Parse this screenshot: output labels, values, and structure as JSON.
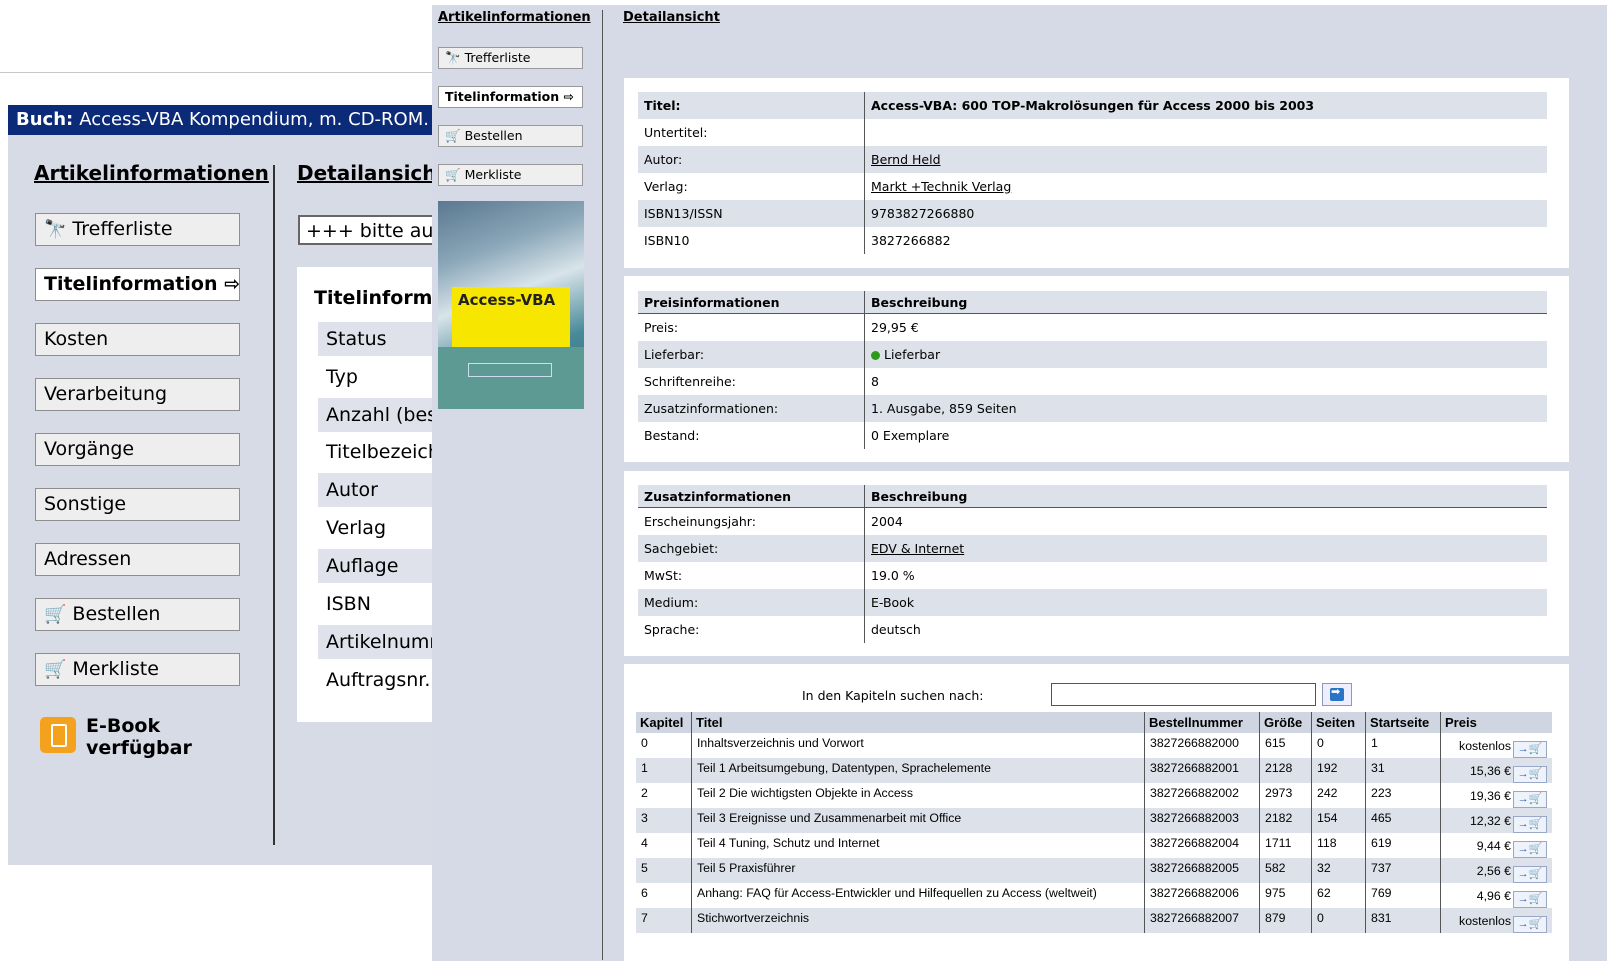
{
  "back": {
    "title_prefix": "Buch:",
    "title": "Access-VBA Kompendium, m. CD-ROM.",
    "nav_heading": "Artikelinformationen",
    "detail_heading": "Detailansicht",
    "buttons": [
      "Trefferliste",
      "Titelinformation",
      "Kosten",
      "Verarbeitung",
      "Vorgänge",
      "Sonstige",
      "Adressen",
      "Bestellen",
      "Merkliste"
    ],
    "ebook_line1": "E-Book",
    "ebook_line2": "verfügbar",
    "select_value": "+++ bitte aus",
    "panel_heading": "Titelinform",
    "panel_rows": [
      "Status",
      "Typ",
      "Anzahl (bes",
      "Titelbezeich",
      "Autor",
      "Verlag",
      "Auflage",
      "ISBN",
      "Artikelnumm",
      "Auftragsnr."
    ]
  },
  "front": {
    "nav_heading": "Artikelinformationen",
    "detail_heading": "Detailansicht",
    "buttons": {
      "trefferliste": "Trefferliste",
      "titelinformation": "Titelinformation",
      "bestellen": "Bestellen",
      "merkliste": "Merkliste"
    },
    "cover_title": "Access-VBA",
    "title_table": {
      "titel_label": "Titel:",
      "titel_value": "Access-VBA: 600 TOP-Makrolösungen für Access 2000 bis 2003",
      "untertitel_label": "Untertitel:",
      "autor_label": "Autor:",
      "autor_value": "Bernd Held",
      "verlag_label": "Verlag:",
      "verlag_value": "Markt +Technik Verlag",
      "isbn13_label": "ISBN13/ISSN",
      "isbn13_value": "9783827266880",
      "isbn10_label": "ISBN10",
      "isbn10_value": "3827266882"
    },
    "price_table": {
      "head1": "Preisinformationen",
      "head2": "Beschreibung",
      "rows": [
        {
          "label": "Preis:",
          "value": "29,95 €"
        },
        {
          "label": "Lieferbar:",
          "value": "Lieferbar"
        },
        {
          "label": "Schriftenreihe:",
          "value": "8"
        },
        {
          "label": "Zusatzinformationen:",
          "value": "1. Ausgabe, 859 Seiten"
        },
        {
          "label": "Bestand:",
          "value": "0 Exemplare"
        }
      ]
    },
    "extra_table": {
      "head1": "Zusatzinformationen",
      "head2": "Beschreibung",
      "rows": [
        {
          "label": "Erscheinungsjahr:",
          "value": "2004"
        },
        {
          "label": "Sachgebiet:",
          "value": "EDV & Internet"
        },
        {
          "label": "MwSt:",
          "value": "19.0 %"
        },
        {
          "label": "Medium:",
          "value": "E-Book"
        },
        {
          "label": "Sprache:",
          "value": "deutsch"
        }
      ]
    },
    "chapters": {
      "search_label": "In den Kapiteln suchen nach:",
      "search_value": "",
      "headers": [
        "Kapitel",
        "Titel",
        "Bestellnummer",
        "Größe",
        "Seiten",
        "Startseite",
        "Preis"
      ],
      "rows": [
        [
          "0",
          "Inhaltsverzeichnis und Vorwort",
          "3827266882000",
          "615",
          "0",
          "1",
          "kostenlos"
        ],
        [
          "1",
          "Teil 1 Arbeitsumgebung, Datentypen, Sprachelemente",
          "3827266882001",
          "2128",
          "192",
          "31",
          "15,36 €"
        ],
        [
          "2",
          "Teil 2 Die wichtigsten Objekte in Access",
          "3827266882002",
          "2973",
          "242",
          "223",
          "19,36 €"
        ],
        [
          "3",
          "Teil 3 Ereignisse und Zusammenarbeit mit Office",
          "3827266882003",
          "2182",
          "154",
          "465",
          "12,32 €"
        ],
        [
          "4",
          "Teil 4 Tuning, Schutz und Internet",
          "3827266882004",
          "1711",
          "118",
          "619",
          "9,44 €"
        ],
        [
          "5",
          "Teil 5 Praxisführer",
          "3827266882005",
          "582",
          "32",
          "737",
          "2,56 €"
        ],
        [
          "6",
          "Anhang: FAQ für Access-Entwickler und Hilfequellen zu Access (weltweit)",
          "3827266882006",
          "975",
          "62",
          "769",
          "4,96 €"
        ],
        [
          "7",
          "Stichwortverzeichnis",
          "3827266882007",
          "879",
          "0",
          "831",
          "kostenlos"
        ]
      ]
    }
  }
}
